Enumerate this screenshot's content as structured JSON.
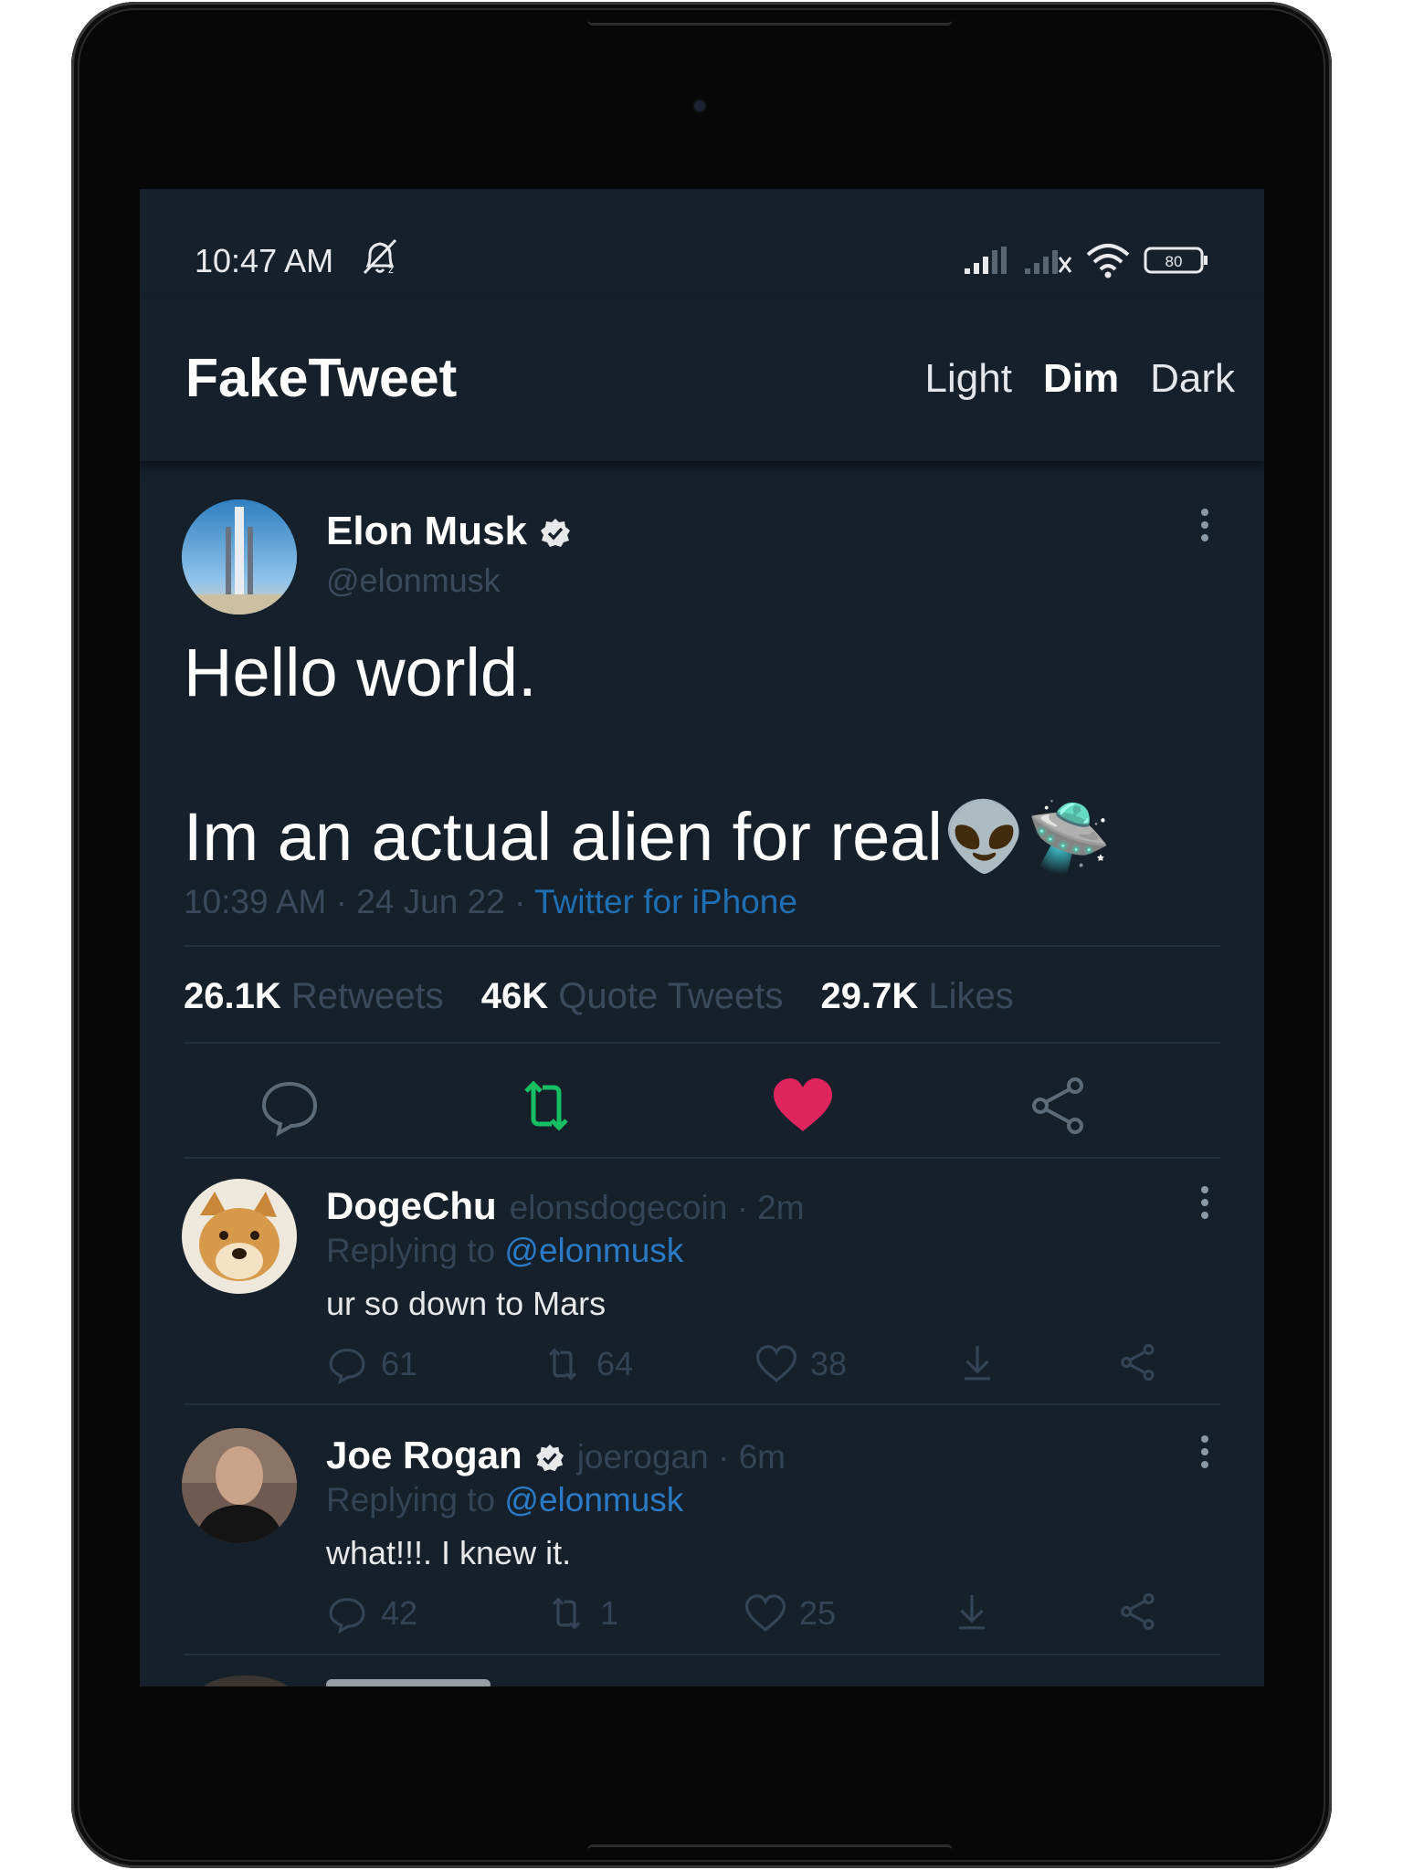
{
  "status_bar": {
    "time": "10:47 AM",
    "icons": [
      "muted-bell-icon",
      "signal-icon",
      "signal-no-sim-icon",
      "wifi-icon",
      "battery-icon"
    ],
    "battery": "80"
  },
  "app_bar": {
    "title": "FakeTweet",
    "themes": [
      "Light",
      "Dim",
      "Dark"
    ],
    "active_theme": "Dim"
  },
  "tweet": {
    "author_name": "Elon Musk",
    "author_handle": "@elonmusk",
    "verified": true,
    "text": "Hello world.\n\nIm an actual alien for real👽🛸",
    "time": "10:39 AM",
    "date": "24 Jun 22",
    "source": "Twitter for iPhone",
    "stats": {
      "retweets_count": "26.1K",
      "retweets_label": "Retweets",
      "quotes_count": "46K",
      "quotes_label": "Quote Tweets",
      "likes_count": "29.7K",
      "likes_label": "Likes"
    }
  },
  "replies": [
    {
      "name": "DogeChu",
      "handle_time": "elonsdogecoin · 2m",
      "verified": false,
      "replying_prefix": "Replying to",
      "replying_to": "@elonmusk",
      "text": "ur so down to Mars",
      "comments": "61",
      "retweets": "64",
      "likes": "38"
    },
    {
      "name": "Joe Rogan",
      "handle_time": "joerogan · 6m",
      "verified": true,
      "replying_prefix": "Replying to",
      "replying_to": "@elonmusk",
      "text": "what!!!. I knew it.",
      "comments": "42",
      "retweets": "1",
      "likes": "25"
    }
  ],
  "colors": {
    "background": "#15202b",
    "retweet_active": "#17bf63",
    "like_active": "#e0245e",
    "link": "#1d9bf0"
  }
}
